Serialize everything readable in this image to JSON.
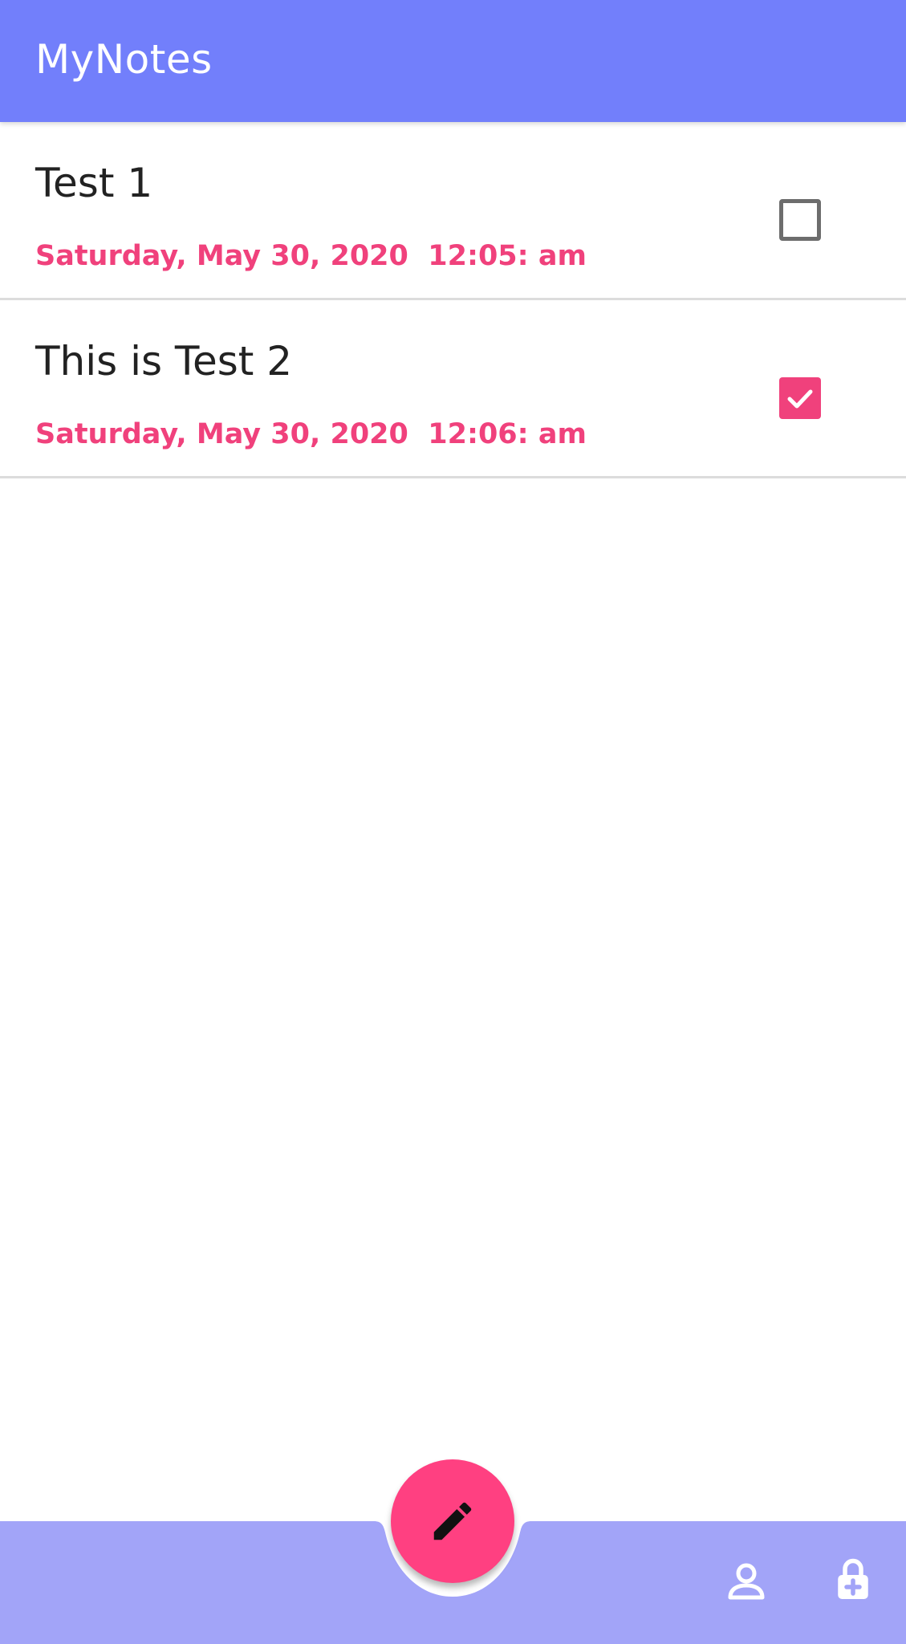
{
  "app_bar": {
    "title": "MyNotes"
  },
  "notes": [
    {
      "title": "Test 1",
      "date": "Saturday, May 30, 2020  12:05: am",
      "done": false
    },
    {
      "title": "This is Test 2",
      "date": "Saturday, May 30, 2020  12:06: am",
      "done": true
    }
  ],
  "bottom_bar": {
    "fab_icon": "pencil-icon",
    "right_icons": [
      "account-icon",
      "lock-add-icon"
    ]
  },
  "colors": {
    "app_bar": "#727ffb",
    "bottom_bar": "#a2a4f8",
    "accent": "#ff4081",
    "date_text": "#f0417c"
  }
}
